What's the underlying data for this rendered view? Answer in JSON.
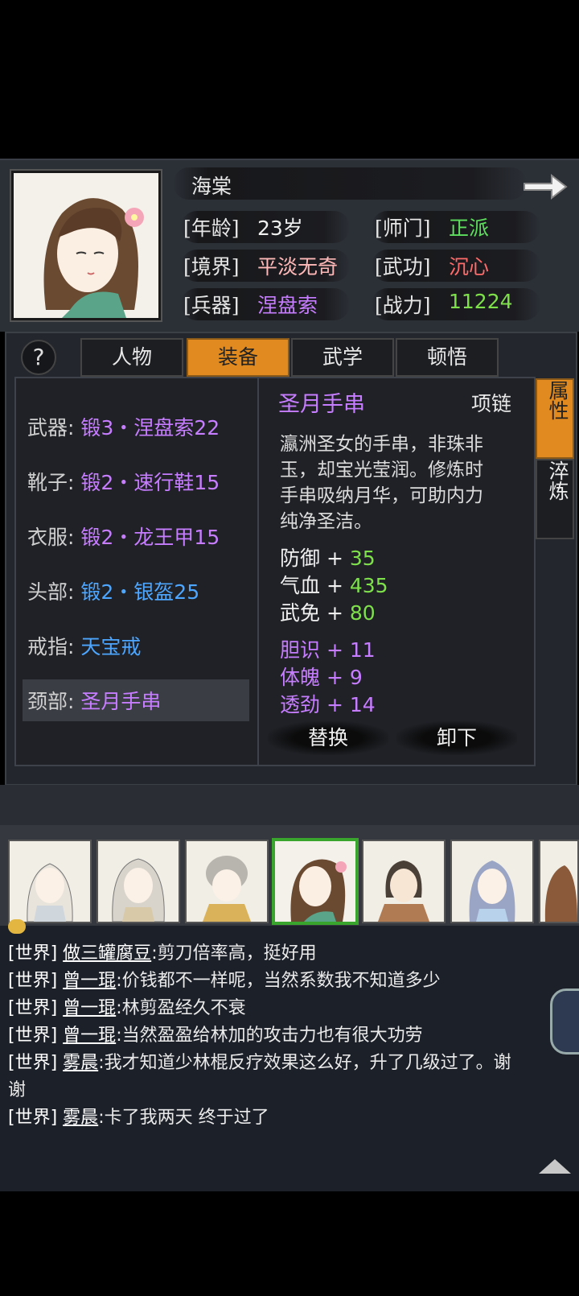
{
  "header": {
    "name": "海棠",
    "rows": [
      {
        "label": "[年龄]",
        "value": "23岁",
        "color": "#f0f0f0"
      },
      {
        "label": "[师门]",
        "value": "正派",
        "color": "#5ee05e"
      },
      {
        "label": "[境界]",
        "value": "平淡无奇",
        "color": "#ffb8b8"
      },
      {
        "label": "[武功]",
        "value": "沉心",
        "color": "#ff6b6b"
      },
      {
        "label": "[兵器]",
        "value": "涅盘索",
        "color": "#c77dff"
      },
      {
        "label": "[战力]",
        "value": "11224",
        "color": "#7ee04a"
      }
    ]
  },
  "help_label": "?",
  "tabs": [
    "人物",
    "装备",
    "武学",
    "顿悟"
  ],
  "active_tab": "装备",
  "side_tabs": [
    "属性",
    "淬炼"
  ],
  "equipment": [
    {
      "slot": "武器:",
      "item": "锻3・涅盘索22",
      "color": "#c77dff"
    },
    {
      "slot": "靴子:",
      "item": "锻2・速行鞋15",
      "color": "#c77dff"
    },
    {
      "slot": "衣服:",
      "item": "锻2・龙王甲15",
      "color": "#c77dff"
    },
    {
      "slot": "头部:",
      "item": "锻2・银盔25",
      "color": "#4da6ff"
    },
    {
      "slot": "戒指:",
      "item": "天宝戒",
      "color": "#4da6ff"
    },
    {
      "slot": "颈部:",
      "item": "圣月手串",
      "color": "#c77dff"
    }
  ],
  "detail": {
    "name": "圣月手串",
    "type": "项链",
    "desc_lines": [
      "瀛洲圣女的手串，非珠非",
      "玉，却宝光莹润。修炼时",
      "手串吸纳月华，可助内力",
      "纯净圣洁。"
    ],
    "stats": [
      {
        "name": "防御",
        "op": "+",
        "value": "35",
        "color": "#f0f0f0"
      },
      {
        "name": "气血",
        "op": "+",
        "value": "435",
        "color": "#f0f0f0"
      },
      {
        "name": "武免",
        "op": "+",
        "value": "80",
        "color": "#f0f0f0"
      },
      {
        "name": "胆识",
        "op": "+",
        "value": "11",
        "color": "#c77dff"
      },
      {
        "name": "体魄",
        "op": "+",
        "value": "9",
        "color": "#c77dff"
      },
      {
        "name": "透劲",
        "op": "+",
        "value": "14",
        "color": "#c77dff"
      }
    ],
    "value_color": "#7ee04a",
    "replace_label": "替换",
    "unequip_label": "卸下"
  },
  "roster_count": 7,
  "chat": [
    {
      "channel": "[世界]",
      "name": "做三罐腐豆",
      "msg": ":剪刀倍率高，挺好用"
    },
    {
      "channel": "[世界]",
      "name": "曾一琨",
      "msg": ":价钱都不一样呢，当然系数我不知道多少"
    },
    {
      "channel": "[世界]",
      "name": "曾一琨",
      "msg": ":林剪盈经久不衰"
    },
    {
      "channel": "[世界]",
      "name": "曾一琨",
      "msg": ":当然盈盈给林加的攻击力也有很大功劳"
    },
    {
      "channel": "[世界]",
      "name": "雾晨",
      "msg": ":我才知道少林棍反疗效果这么好，升了几级过了。谢",
      "cont": "谢"
    },
    {
      "channel": "[世界]",
      "name": "雾晨",
      "msg": ":卡了我两天 终于过了"
    }
  ]
}
